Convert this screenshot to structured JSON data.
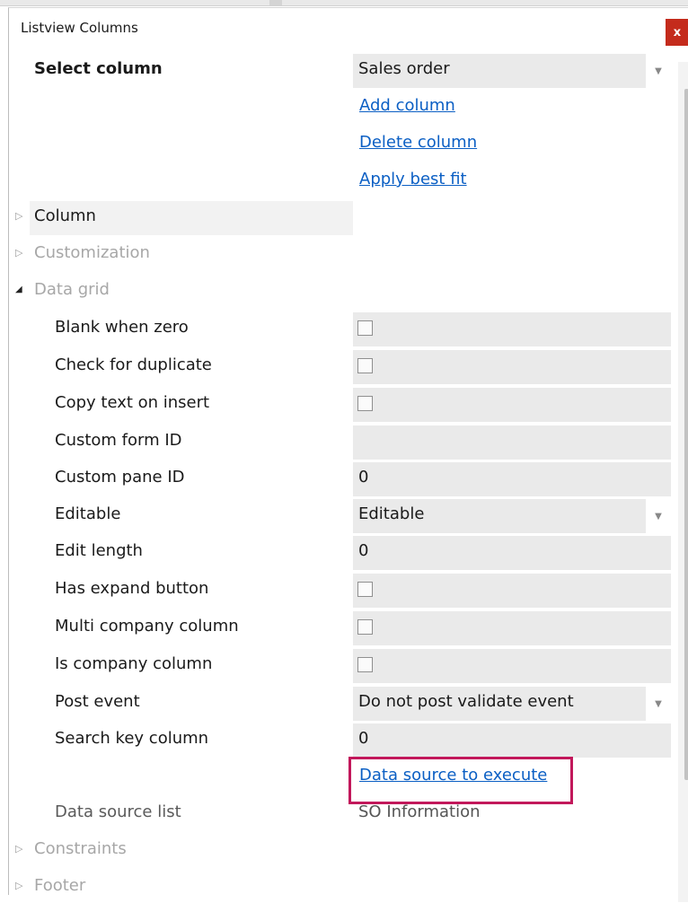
{
  "dialog": {
    "title": "Listview Columns",
    "close_label": "x"
  },
  "select_column": {
    "label": "Select column",
    "value": "Sales order"
  },
  "actions": {
    "add_column": "Add column",
    "delete_column": "Delete column",
    "apply_best_fit": "Apply best fit"
  },
  "sections": {
    "column": "Column",
    "customization": "Customization",
    "data_grid": "Data grid",
    "constraints": "Constraints",
    "footer": "Footer"
  },
  "data_grid": {
    "blank_when_zero": {
      "label": "Blank when zero",
      "checked": false
    },
    "check_for_duplicate": {
      "label": "Check for duplicate",
      "checked": false
    },
    "copy_text_on_insert": {
      "label": "Copy text on insert",
      "checked": false
    },
    "custom_form_id": {
      "label": "Custom form ID",
      "value": ""
    },
    "custom_pane_id": {
      "label": "Custom pane ID",
      "value": "0"
    },
    "editable": {
      "label": "Editable",
      "value": "Editable"
    },
    "edit_length": {
      "label": "Edit length",
      "value": "0"
    },
    "has_expand_button": {
      "label": "Has expand button",
      "checked": false
    },
    "multi_company_column": {
      "label": "Multi company column",
      "checked": false
    },
    "is_company_column": {
      "label": "Is company column",
      "checked": false
    },
    "post_event": {
      "label": "Post event",
      "value": "Do not post validate event"
    },
    "search_key_column": {
      "label": "Search key column",
      "value": "0"
    },
    "data_source_link": "Data source to execute",
    "data_source_list": {
      "label": "Data source list",
      "value": "SO Information"
    }
  },
  "colors": {
    "link": "#0b5fc4",
    "close": "#c42b1c",
    "highlight": "#c2185b",
    "value_bg": "#eaeaea"
  }
}
